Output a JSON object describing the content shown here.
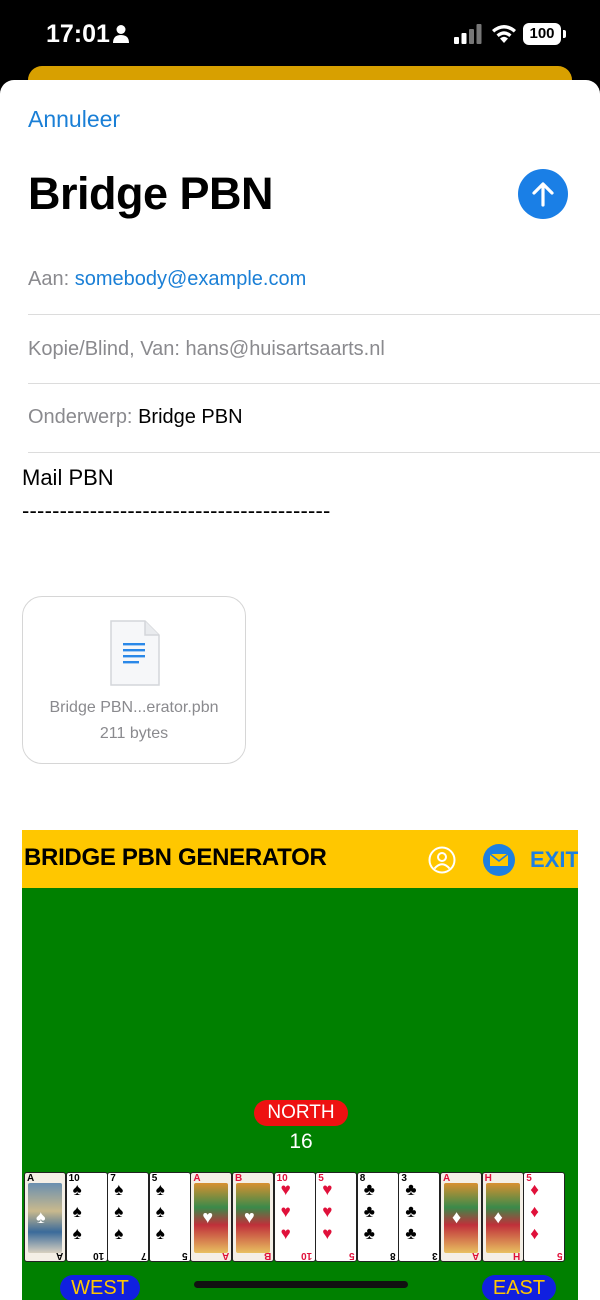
{
  "status_bar": {
    "time": "17:01",
    "battery": "100"
  },
  "compose": {
    "cancel_label": "Annuleer",
    "title": "Bridge PBN",
    "to_label": "Aan:",
    "to_value": "somebody@example.com",
    "cc_label": "Kopie/Blind, Van:",
    "cc_value": "hans@huisartsaarts.nl",
    "subject_label": "Onderwerp:",
    "subject_value": "Bridge PBN",
    "body_line1": "Mail PBN",
    "body_line2": "-----------------------------------------",
    "attachment": {
      "name": "Bridge PBN...erator.pbn",
      "size": "211 bytes"
    },
    "accent_color": "#1a7fd6"
  },
  "app": {
    "title": "BRIDGE PBN GENERATOR",
    "exit_label": "EXIT",
    "north_label": "NORTH",
    "north_points": "16",
    "west_label": "WEST",
    "east_label": "EAST",
    "header_color": "#ffc700",
    "table_color": "#008000",
    "north_hand": [
      {
        "rank": "A",
        "suit": "♠",
        "color": "#000",
        "face": true
      },
      {
        "rank": "10",
        "suit": "♠",
        "color": "#000",
        "face": false
      },
      {
        "rank": "7",
        "suit": "♠",
        "color": "#000",
        "face": false
      },
      {
        "rank": "5",
        "suit": "♠",
        "color": "#000",
        "face": false
      },
      {
        "rank": "A",
        "suit": "♥",
        "color": "#e0103a",
        "face": true
      },
      {
        "rank": "B",
        "suit": "♥",
        "color": "#e0103a",
        "face": true
      },
      {
        "rank": "10",
        "suit": "♥",
        "color": "#e0103a",
        "face": false
      },
      {
        "rank": "5",
        "suit": "♥",
        "color": "#e0103a",
        "face": false
      },
      {
        "rank": "8",
        "suit": "♣",
        "color": "#000",
        "face": false
      },
      {
        "rank": "3",
        "suit": "♣",
        "color": "#000",
        "face": false
      },
      {
        "rank": "A",
        "suit": "♦",
        "color": "#e0103a",
        "face": true
      },
      {
        "rank": "H",
        "suit": "♦",
        "color": "#e0103a",
        "face": true
      },
      {
        "rank": "5",
        "suit": "♦",
        "color": "#e0103a",
        "face": false
      }
    ]
  }
}
